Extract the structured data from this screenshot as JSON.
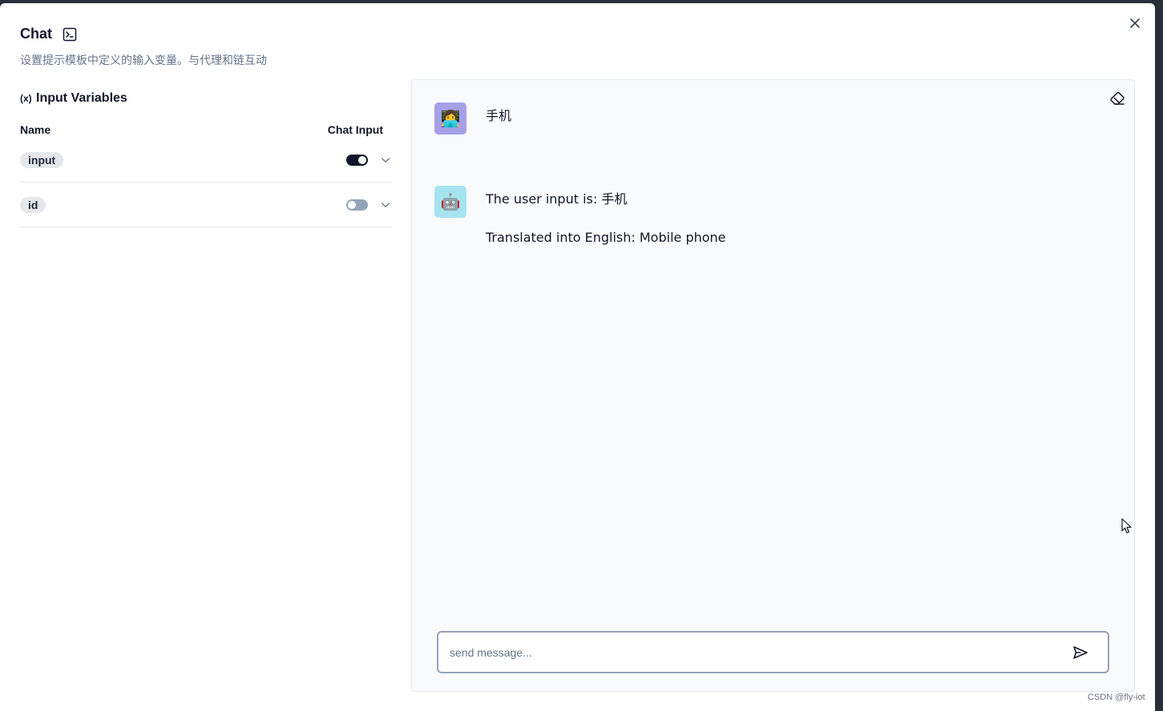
{
  "dialog": {
    "title": "Chat",
    "subtitle": "设置提示模板中定义的输入变量。与代理和链互动"
  },
  "variables_panel": {
    "title": "Input Variables",
    "col_name": "Name",
    "col_chat_input": "Chat Input",
    "rows": [
      {
        "name": "input",
        "chat_input": true
      },
      {
        "name": "id",
        "chat_input": false
      }
    ]
  },
  "chat": {
    "messages": [
      {
        "role": "user",
        "avatar": "👩‍💻",
        "lines": [
          "手机"
        ]
      },
      {
        "role": "bot",
        "avatar": "🤖",
        "lines": [
          "The user input is: 手机",
          "Translated into English: Mobile phone"
        ]
      }
    ],
    "input_placeholder": "send message...",
    "input_value": ""
  },
  "icons": {
    "close": "close-icon",
    "terminal": "terminal-icon",
    "variable": "variable-icon",
    "eraser": "eraser-icon",
    "send": "send-icon",
    "chevron": "chevron-down-icon"
  },
  "colors": {
    "toggle_on": "#0f172a",
    "toggle_off": "#94a3b8",
    "user_avatar_bg": "#a5a0e8",
    "bot_avatar_bg": "#a5e4ef"
  },
  "watermark": "CSDN @fly-iot"
}
